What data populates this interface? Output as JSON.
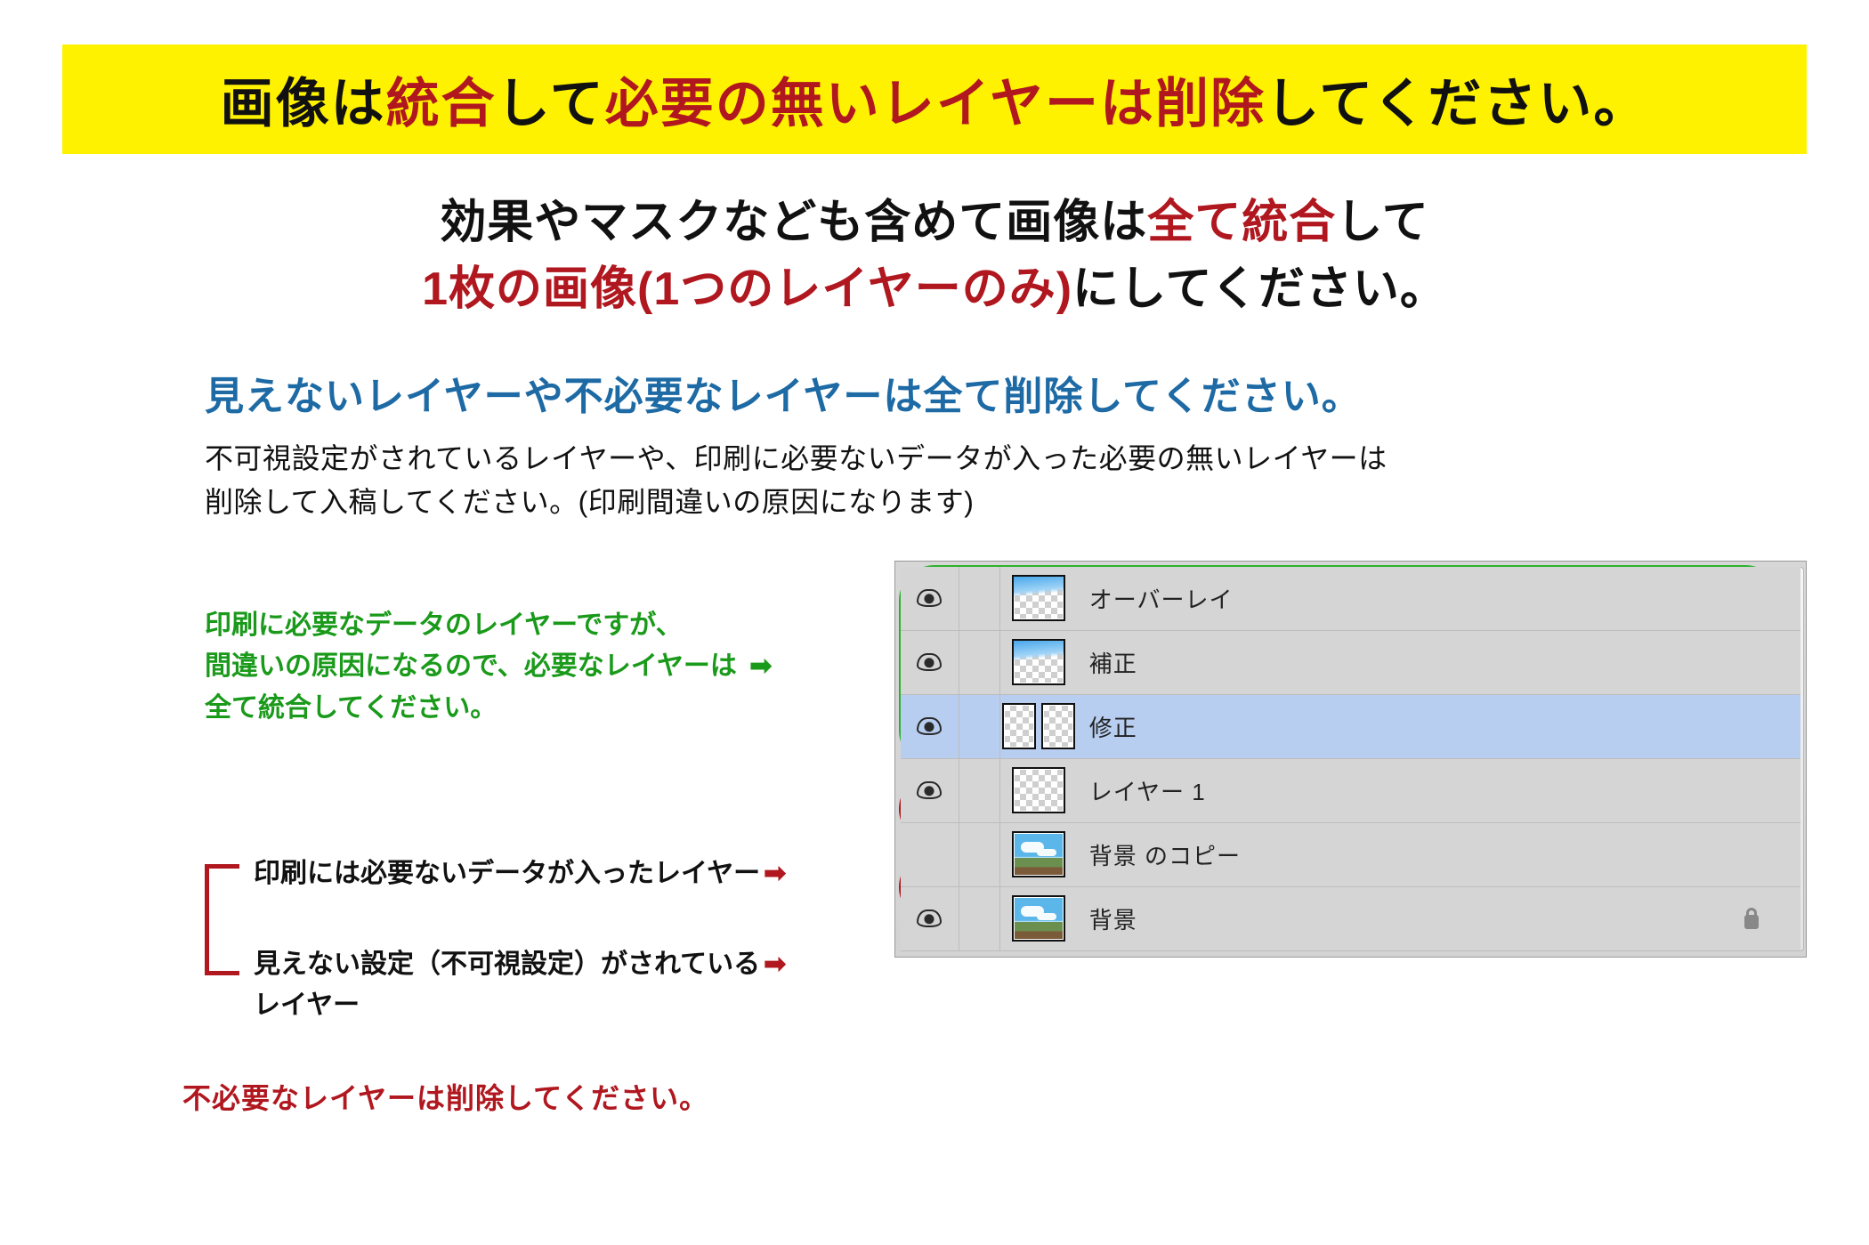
{
  "banner": {
    "t1": "画像は",
    "t2": "統合",
    "t3": "して",
    "t4": "必要の無いレイヤーは削除",
    "t5": "してください。"
  },
  "subhead": {
    "l1a": "効果やマスクなども含めて画像は",
    "l1b": "全て統合",
    "l1c": "して",
    "l2a": "1枚の画像(1つのレイヤーのみ)",
    "l2b": "にしてください。"
  },
  "blueTitle": "見えないレイヤーや不必要なレイヤーは全て削除してください。",
  "bodyText": "不可視設定がされているレイヤーや、印刷に必要ないデータが入った必要の無いレイヤーは\n削除して入稿してください。(印刷間違いの原因になります)",
  "annotations": {
    "greenLine1": "印刷に必要なデータのレイヤーですが、",
    "greenLine2Pre": "間違いの原因になるので、必要なレイヤーは",
    "greenLine3": "全て統合してください。",
    "red1": "印刷には必要ないデータが入ったレイヤー",
    "red2a": "見えない設定（不可視設定）がされている",
    "red2b": "レイヤー",
    "redBold": "不必要なレイヤーは削除してください。",
    "arrow": "➡"
  },
  "layers": [
    {
      "name": "オーバーレイ",
      "visible": true,
      "thumb": "sky-checker",
      "selected": false,
      "locked": false
    },
    {
      "name": "補正",
      "visible": true,
      "thumb": "sky-checker",
      "selected": false,
      "locked": false
    },
    {
      "name": "修正",
      "visible": true,
      "thumb": "mask",
      "selected": true,
      "locked": false
    },
    {
      "name": "レイヤー 1",
      "visible": true,
      "thumb": "checker",
      "selected": false,
      "locked": false
    },
    {
      "name": "背景 のコピー",
      "visible": false,
      "thumb": "photo",
      "selected": false,
      "locked": false
    },
    {
      "name": "背景",
      "visible": true,
      "thumb": "photo",
      "selected": false,
      "locked": true
    }
  ]
}
